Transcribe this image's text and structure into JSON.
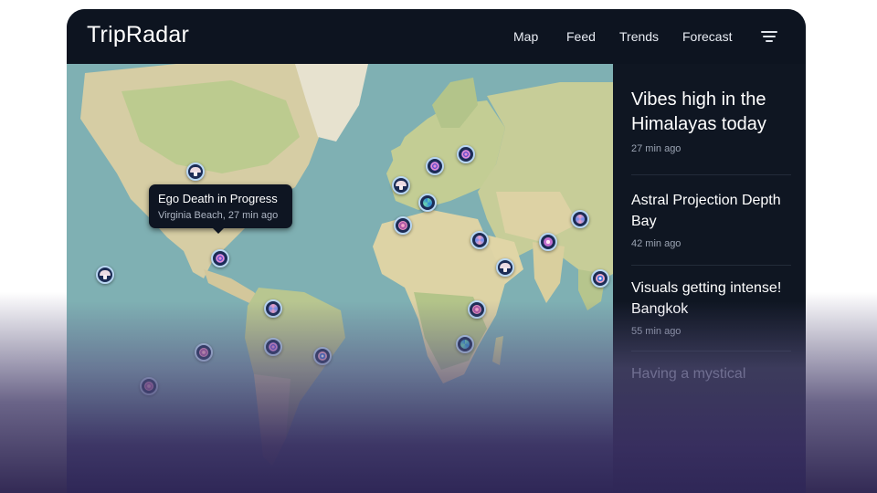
{
  "app": {
    "brand": "TripRadar"
  },
  "nav": {
    "map": "Map",
    "feed": "Feed",
    "trends": "Trends",
    "forecast": "Forecast"
  },
  "tooltip": {
    "title": "Ego Death in Progress",
    "subtitle": "Virginia Beach, 27 min ago"
  },
  "feed": {
    "items": [
      {
        "title": "Vibes high in the Himalayas today",
        "time": "27 min ago"
      },
      {
        "title": "Astral Projection Depth Bay",
        "time": "42 min ago"
      },
      {
        "title": "Visuals getting intense! Bangkok",
        "time": "55 min ago"
      },
      {
        "title": "Having a mystical"
      }
    ]
  },
  "markers": [
    {
      "icon": "mushroom-icon"
    },
    {
      "icon": "mushroom-icon"
    },
    {
      "icon": "mandala-icon"
    },
    {
      "icon": "swirl-icon"
    },
    {
      "icon": "flower-icon"
    },
    {
      "icon": "mandala-icon"
    },
    {
      "icon": "eye-icon"
    },
    {
      "icon": "flower-icon"
    },
    {
      "icon": "mushroom-icon"
    },
    {
      "icon": "mandala-icon"
    },
    {
      "icon": "mandala-icon"
    },
    {
      "icon": "leaf-icon"
    },
    {
      "icon": "mushroom-icon"
    },
    {
      "icon": "mandala-icon"
    },
    {
      "icon": "swirl-icon"
    },
    {
      "icon": "flower-icon"
    },
    {
      "icon": "swirl-icon"
    },
    {
      "icon": "eye-icon"
    },
    {
      "icon": "leaf-icon"
    },
    {
      "icon": "star-icon"
    },
    {
      "icon": "mandala-icon"
    }
  ],
  "colors": {
    "topbar": "#0d1420",
    "panel": "#0f1622",
    "ocean": "#7fb0b3",
    "land": "#d9cfa6",
    "forest": "#b9c68d",
    "marker_ring": "#b9d7f2",
    "marker_fill": "#1c2c55"
  }
}
